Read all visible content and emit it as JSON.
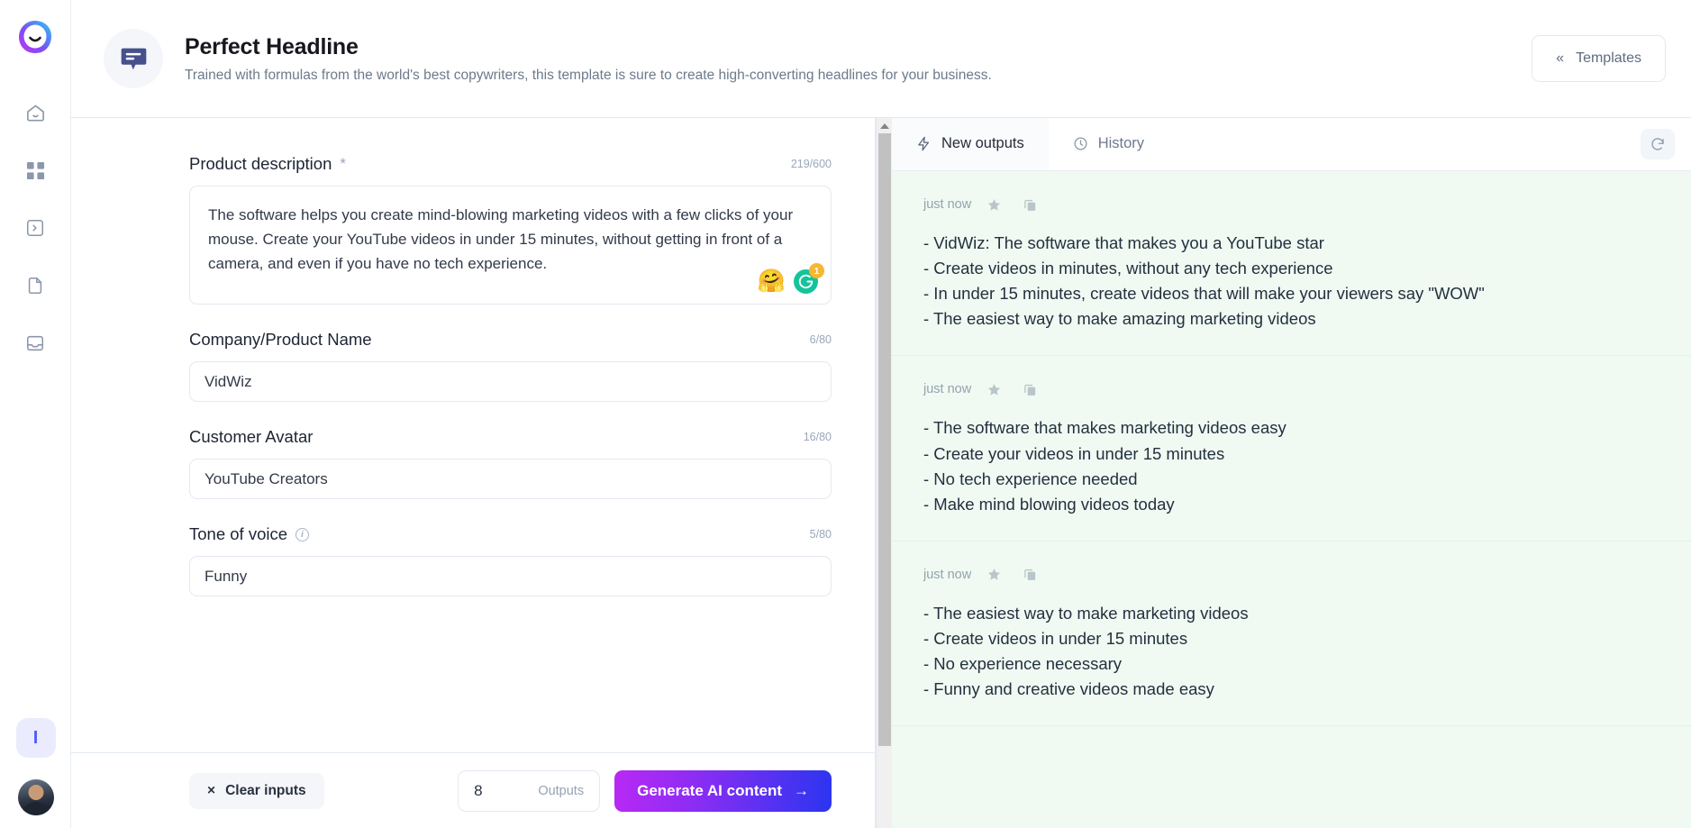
{
  "brand": {
    "logo_name": "app-logo",
    "accent": "#4f5dfb",
    "output_bg": "#f0faf2"
  },
  "rail": {
    "badge_label": "I",
    "items": [
      {
        "name": "home-icon",
        "label": "Home"
      },
      {
        "name": "grid-icon",
        "label": "Templates"
      },
      {
        "name": "code-icon",
        "label": "Commands"
      },
      {
        "name": "document-icon",
        "label": "Documents"
      },
      {
        "name": "inbox-icon",
        "label": "Inbox"
      }
    ]
  },
  "header": {
    "title": "Perfect Headline",
    "subtitle": "Trained with formulas from the world's best copywriters, this template is sure to create high-converting headlines for your business.",
    "templates_button": "Templates",
    "templates_chevron": "«"
  },
  "form": {
    "fields": [
      {
        "label": "Product description",
        "required": "*",
        "counter": "219/600",
        "value": "The software helps you create mind-blowing marketing videos with a few clicks of your mouse. Create your YouTube videos in under 15 minutes, without getting in front of a camera, and even if you have no tech experience.",
        "type": "textarea",
        "grammarly_badge": "1"
      },
      {
        "label": "Company/Product Name",
        "counter": "6/80",
        "value": "VidWiz",
        "type": "input"
      },
      {
        "label": "Customer Avatar",
        "counter": "16/80",
        "value": "YouTube Creators",
        "type": "input"
      },
      {
        "label": "Tone of voice",
        "counter": "5/80",
        "value": "Funny",
        "type": "input",
        "info": true
      }
    ]
  },
  "actions": {
    "clear_label": "Clear inputs",
    "clear_icon": "×",
    "outputs_count": "8",
    "outputs_label": "Outputs",
    "generate_label": "Generate AI content",
    "generate_arrow": "→"
  },
  "outputs": {
    "tabs": [
      {
        "label": "New outputs",
        "icon": "lightning-icon",
        "active": true
      },
      {
        "label": "History",
        "icon": "clock-icon",
        "active": false
      }
    ],
    "refresh_icon": "refresh-icon",
    "cards": [
      {
        "timestamp": "just now",
        "lines": [
          "- VidWiz: The software that makes you a YouTube star",
          "- Create videos in minutes, without any tech experience",
          "- In under 15 minutes, create videos that will make your viewers say \"WOW\"",
          "- The easiest way to make amazing marketing videos"
        ]
      },
      {
        "timestamp": "just now",
        "lines": [
          "- The software that makes marketing videos easy",
          "- Create your videos in under 15 minutes",
          "- No tech experience needed",
          "- Make mind blowing videos today"
        ]
      },
      {
        "timestamp": "just now",
        "lines": [
          "- The easiest way to make marketing videos",
          "- Create videos in under 15 minutes",
          "- No experience necessary",
          "- Funny and creative videos made easy"
        ]
      }
    ]
  }
}
